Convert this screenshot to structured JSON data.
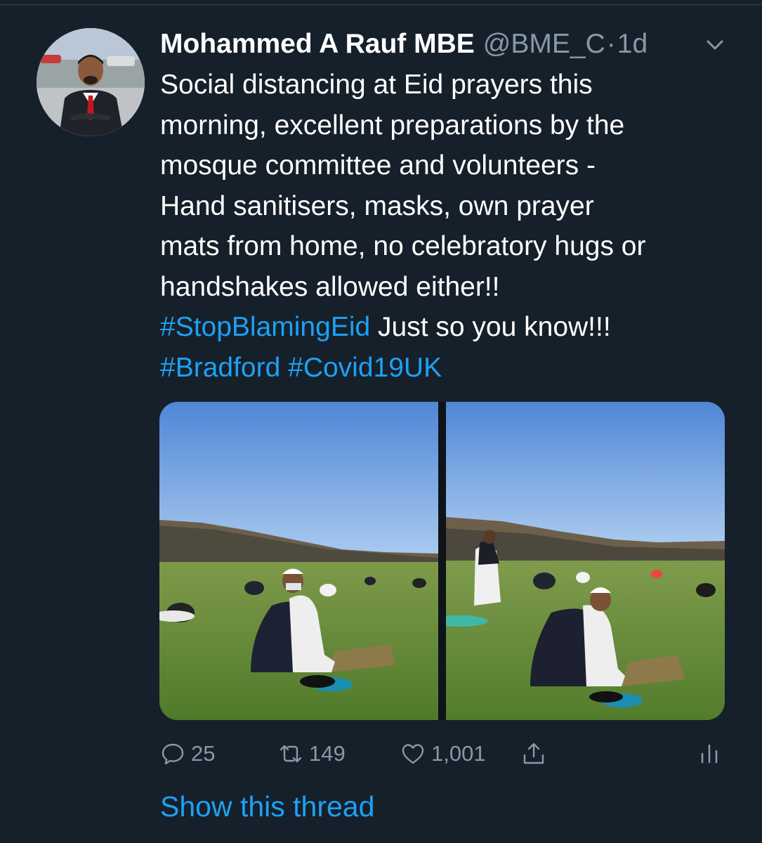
{
  "tweet": {
    "author": {
      "display_name": "Mohammed A Rauf MBE",
      "handle": "@BME_C",
      "avatar_icon": "profile-photo"
    },
    "separator": "·",
    "timestamp": "1d",
    "text_lines": [
      {
        "plain": "Social distancing at Eid prayers this"
      },
      {
        "plain": "morning, excellent preparations by the"
      },
      {
        "plain": "mosque committee and volunteers -"
      },
      {
        "plain": "Hand sanitisers, masks, own prayer"
      },
      {
        "plain": "mats from home, no celebratory hugs or"
      },
      {
        "plain": "handshakes allowed either!!"
      }
    ],
    "hashtag_line_1": {
      "hashtag": "#StopBlamingEid",
      "rest": " Just so you know!!!"
    },
    "hashtag_line_2": {
      "hashtag_a": "#Bradford",
      "hashtag_b": "#Covid19UK"
    },
    "media": [
      {
        "icon": "photo-eid-prayers-field-1"
      },
      {
        "icon": "photo-eid-prayers-field-2"
      }
    ],
    "actions": {
      "replies": "25",
      "retweets": "149",
      "likes": "1,001"
    },
    "show_thread_label": "Show this thread"
  },
  "colors": {
    "background": "#15202b",
    "text_primary": "#ffffff",
    "text_secondary": "#8899a6",
    "accent": "#1da1f2"
  }
}
